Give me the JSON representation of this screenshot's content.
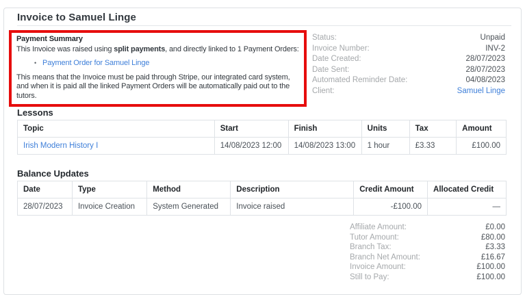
{
  "page": {
    "title": "Invoice to Samuel Linge"
  },
  "colors": {
    "highlight_red": "#e60d0d",
    "link_blue": "#3e7fd9",
    "label_gray": "#a5a8ab",
    "text_dark": "#32383e"
  },
  "payment_summary": {
    "heading": "Payment Summary",
    "line1_prefix": "This Invoice was raised using ",
    "line1_bold": "split payments",
    "line1_suffix": ", and directly linked to 1 Payment Orders:",
    "bullet": "•",
    "order_link": "Payment Order for Samuel Linge",
    "paragraph": "This means that the Invoice must be paid through Stripe, our integrated card system, and when it is paid all the linked Payment Orders will be automatically paid out to the tutors."
  },
  "details": {
    "rows": [
      {
        "label": "Status:",
        "value": "Unpaid"
      },
      {
        "label": "Invoice Number:",
        "value": "INV-2"
      },
      {
        "label": "Date Created:",
        "value": "28/07/2023"
      },
      {
        "label": "Date Sent:",
        "value": "28/07/2023"
      },
      {
        "label": "Automated Reminder Date:",
        "value": "04/08/2023"
      },
      {
        "label": "Client:",
        "value": "Samuel Linge"
      }
    ]
  },
  "lessons": {
    "heading": "Lessons",
    "columns": [
      "Topic",
      "Start",
      "Finish",
      "Units",
      "Tax",
      "Amount"
    ],
    "rows": [
      {
        "topic": "Irish Modern History I",
        "start": "14/08/2023 12:00",
        "finish": "14/08/2023 13:00",
        "units": "1 hour",
        "tax": "£3.33",
        "amount": "£100.00"
      }
    ]
  },
  "balance_updates": {
    "heading": "Balance Updates",
    "columns": [
      "Date",
      "Type",
      "Method",
      "Description",
      "Credit Amount",
      "Allocated Credit"
    ],
    "rows": [
      {
        "date": "28/07/2023",
        "type": "Invoice Creation",
        "method": "System Generated",
        "description": "Invoice raised",
        "credit_amount": "-£100.00",
        "allocated_credit": "—"
      }
    ]
  },
  "totals": {
    "rows": [
      {
        "label": "Affiliate Amount:",
        "value": "£0.00"
      },
      {
        "label": "Tutor Amount:",
        "value": "£80.00"
      },
      {
        "label": "Branch Tax:",
        "value": "£3.33"
      },
      {
        "label": "Branch Net Amount:",
        "value": "£16.67"
      },
      {
        "label": "Invoice Amount:",
        "value": "£100.00"
      },
      {
        "label": "Still to Pay:",
        "value": "£100.00"
      }
    ]
  }
}
